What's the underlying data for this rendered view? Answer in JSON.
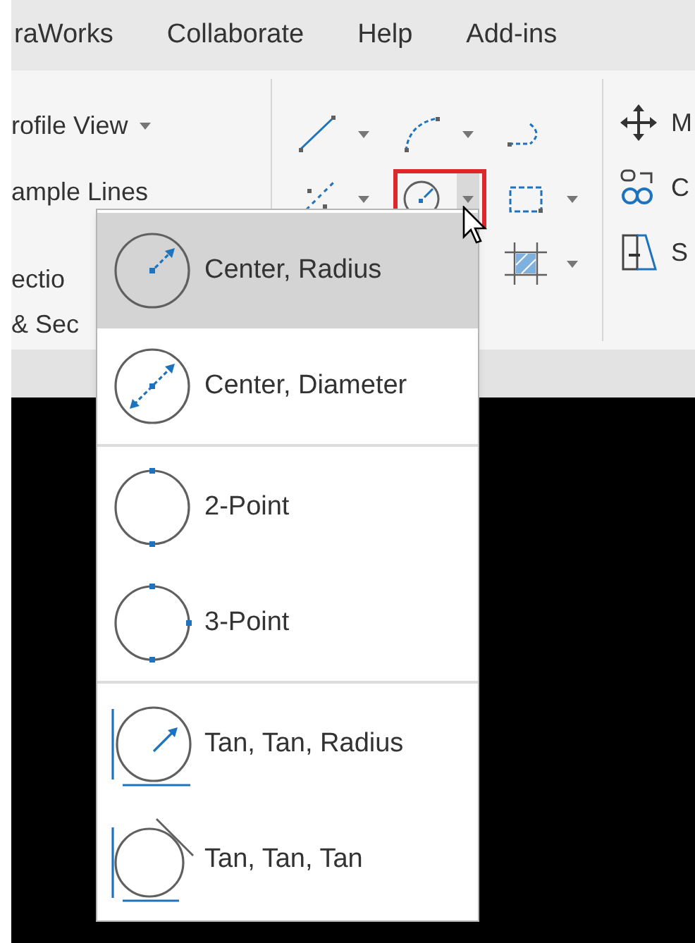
{
  "menu_bar": {
    "tabs": [
      {
        "label": "raWorks"
      },
      {
        "label": "Collaborate"
      },
      {
        "label": "Help"
      },
      {
        "label": "Add-ins"
      }
    ]
  },
  "ribbon": {
    "left_items": [
      {
        "label": "rofile View",
        "dropdown": true
      },
      {
        "label": "ample Lines",
        "dropdown": false
      },
      {
        "label": "ectio",
        "dropdown": false
      },
      {
        "label": "& Sec",
        "dropdown": false
      }
    ],
    "draw_tools": [
      [
        {
          "kind": "line",
          "dropdown": true,
          "highlighted": false
        },
        {
          "kind": "arc",
          "dropdown": true,
          "highlighted": false
        },
        {
          "kind": "polyline",
          "dropdown": false,
          "highlighted": false
        }
      ],
      [
        {
          "kind": "xline",
          "dropdown": true,
          "highlighted": false
        },
        {
          "kind": "circle",
          "dropdown": true,
          "highlighted": true
        },
        {
          "kind": "rectangle",
          "dropdown": true,
          "highlighted": false
        }
      ],
      [
        {
          "kind": "hatch",
          "dropdown": true,
          "highlighted": false
        }
      ]
    ],
    "modify_items": [
      {
        "kind": "move",
        "label": "M"
      },
      {
        "kind": "copy",
        "label": "C"
      },
      {
        "kind": "stretch",
        "label": "S"
      }
    ]
  },
  "dropdown": {
    "groups": [
      [
        {
          "kind": "center-radius",
          "label": "Center, Radius",
          "selected": true
        },
        {
          "kind": "center-diameter",
          "label": "Center, Diameter",
          "selected": false
        }
      ],
      [
        {
          "kind": "two-point",
          "label": "2-Point",
          "selected": false
        },
        {
          "kind": "three-point",
          "label": "3-Point",
          "selected": false
        }
      ],
      [
        {
          "kind": "tan-tan-radius",
          "label": "Tan, Tan, Radius",
          "selected": false
        },
        {
          "kind": "tan-tan-tan",
          "label": "Tan, Tan, Tan",
          "selected": false
        }
      ]
    ]
  }
}
